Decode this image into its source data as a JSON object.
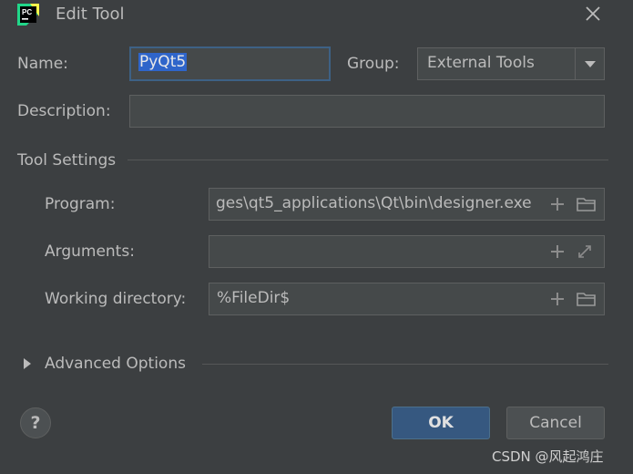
{
  "window": {
    "title": "Edit Tool"
  },
  "form": {
    "name_label": "Name:",
    "name_value": "PyQt5",
    "group_label": "Group:",
    "group_value": "External Tools",
    "description_label": "Description:",
    "description_value": ""
  },
  "tool_settings": {
    "heading": "Tool Settings",
    "program_label": "Program:",
    "program_value": "ges\\qt5_applications\\Qt\\bin\\designer.exe",
    "arguments_label": "Arguments:",
    "arguments_value": "",
    "working_dir_label": "Working directory:",
    "working_dir_value": "%FileDir$"
  },
  "advanced": {
    "label": "Advanced Options"
  },
  "buttons": {
    "help_label": "?",
    "ok_label": "OK",
    "cancel_label": "Cancel"
  },
  "watermark": "CSDN @风起鸿庄",
  "icons": {
    "app": "pycharm-logo-icon",
    "close": "close-icon",
    "dropdown": "chevron-down-icon",
    "add": "plus-icon",
    "browse": "folder-icon",
    "expand": "expand-icon",
    "disclosure": "triangle-right-icon"
  },
  "colors": {
    "background": "#3c3f41",
    "field": "#45494a",
    "focus_border": "#3d6185",
    "selection": "#2f65ca",
    "ok_button": "#365880"
  }
}
